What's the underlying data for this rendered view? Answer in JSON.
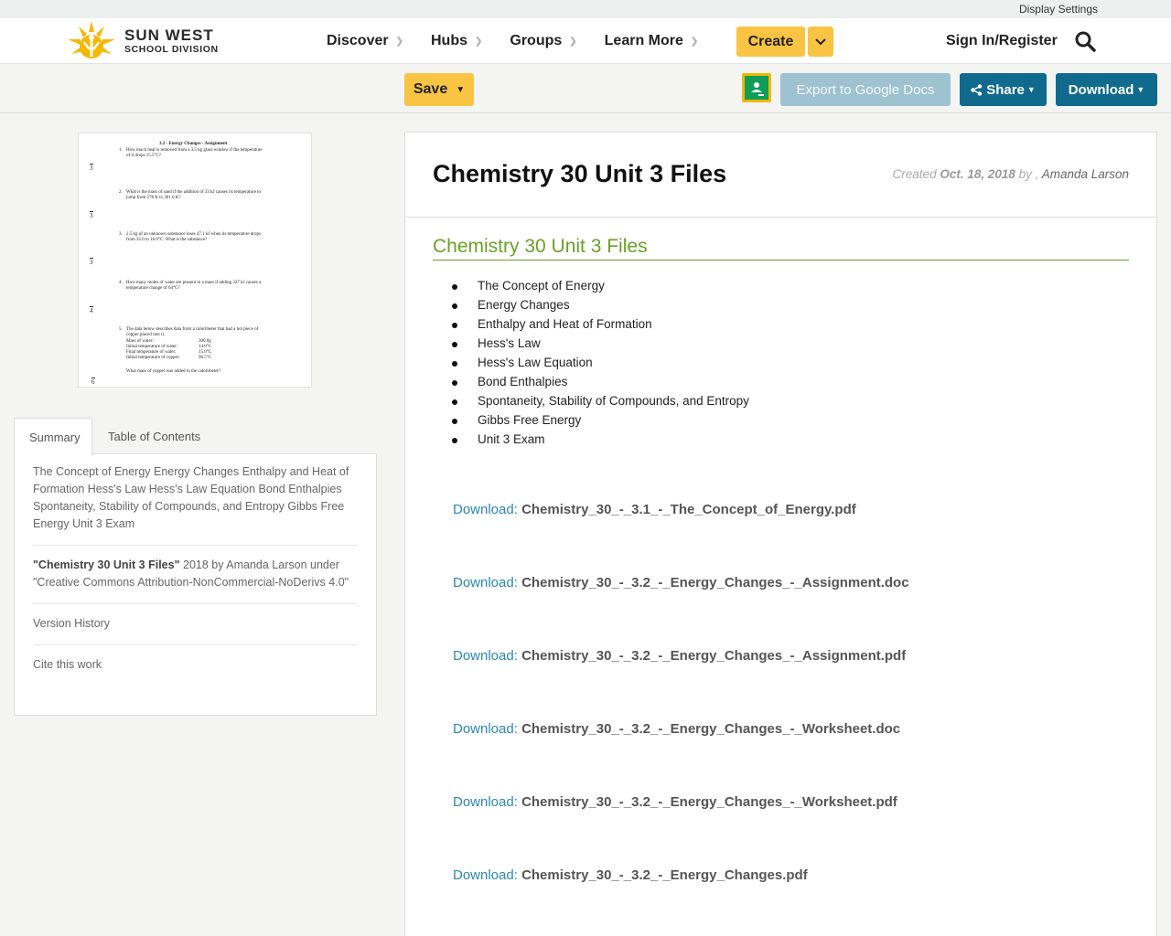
{
  "top_strip": {
    "display_settings": "Display Settings"
  },
  "brand": {
    "line1": "SUN WEST",
    "line2": "SCHOOL DIVISION"
  },
  "nav": {
    "items": [
      {
        "label": "Discover"
      },
      {
        "label": "Hubs"
      },
      {
        "label": "Groups"
      },
      {
        "label": "Learn More"
      }
    ],
    "create_label": "Create",
    "signin_label": "Sign In/Register"
  },
  "toolbar": {
    "save_label": "Save",
    "export_label": "Export to Google Docs",
    "share_label": "Share",
    "download_label": "Download"
  },
  "thumbnail": {
    "title": "3.2 - Energy Changes - Assignment",
    "questions": [
      {
        "n": "1.",
        "text": "How much heat is removed from a 3.5 kg glass window if the temperature",
        "text2": "of it drops 15.5°C?",
        "score": "3"
      },
      {
        "n": "2.",
        "text": "What is the mass of sand if the addition of 33 kJ causes its temperature to",
        "text2": "jump from 278 K to 301.6 K?",
        "score": "3"
      },
      {
        "n": "3.",
        "text": "2.5 kg of an unknown substance loses 47.1 kJ when its temperature drops",
        "text2": "from 35.0 to 16.0°C. What is the substance?",
        "score": "3"
      },
      {
        "n": "4.",
        "text": "How many moles of water are present in a mass if adding 327 kJ causes a",
        "text2": "temperature change of 64°C?",
        "score": "4"
      },
      {
        "n": "5.",
        "text": "The data below describes data from a calorimeter that had a hot piece of",
        "text2": "copper placed into it.",
        "score": "6"
      }
    ],
    "table": [
      {
        "label": "Mass of water:",
        "value": "300.0g"
      },
      {
        "label": "Initial temperature of water:",
        "value": "14.0°C"
      },
      {
        "label": "Final temperature of water:",
        "value": "15.0°C"
      },
      {
        "label": "Initial temperature of copper:",
        "value": "96.5°C"
      }
    ],
    "final_question": "What mass of copper was added to the calorimeter?"
  },
  "side_tabs": {
    "summary": "Summary",
    "toc": "Table of Contents"
  },
  "summary": {
    "text": "The Concept of Energy Energy Changes Enthalpy and Heat of Formation Hess's Law Hess's Law Equation Bond Enthalpies Spontaneity, Stability of Compounds, and Entropy Gibbs Free Energy Unit 3 Exam",
    "credit_title": "\"Chemistry 30 Unit 3 Files\"",
    "credit_rest": " 2018 by Amanda Larson under \"Creative Commons Attribution-NonCommercial-NoDerivs 4.0\"",
    "version_history": "Version History",
    "cite": "Cite this work"
  },
  "resource": {
    "title": "Chemistry 30 Unit 3 Files",
    "created_prefix": "Created",
    "created_date": "Oct. 18, 2018",
    "created_by": "by ,",
    "author": "Amanda Larson",
    "section_title": "Chemistry 30 Unit 3 Files",
    "topics": [
      "The Concept of Energy",
      "Energy Changes",
      "Enthalpy and Heat of Formation",
      "Hess's Law",
      "Hess's Law Equation",
      "Bond Enthalpies",
      "Spontaneity, Stability of Compounds, and Entropy",
      "Gibbs Free Energy",
      "Unit 3 Exam"
    ],
    "download_prefix": "Download:",
    "files": [
      "Chemistry_30_-_3.1_-_The_Concept_of_Energy.pdf",
      "Chemistry_30_-_3.2_-_Energy_Changes_-_Assignment.doc",
      "Chemistry_30_-_3.2_-_Energy_Changes_-_Assignment.pdf",
      "Chemistry_30_-_3.2_-_Energy_Changes_-_Worksheet.doc",
      "Chemistry_30_-_3.2_-_Energy_Changes_-_Worksheet.pdf",
      "Chemistry_30_-_3.2_-_Energy_Changes.pdf"
    ]
  },
  "colors": {
    "accent_yellow": "#f9c443",
    "primary_blue": "#0f6a8d",
    "link_blue": "#2a87b0",
    "section_green": "#6aa126"
  },
  "icons": [
    "sun-logo-icon",
    "chevron-down-icon",
    "search-icon",
    "google-classroom-icon",
    "share-icon",
    "caret-down-icon"
  ]
}
